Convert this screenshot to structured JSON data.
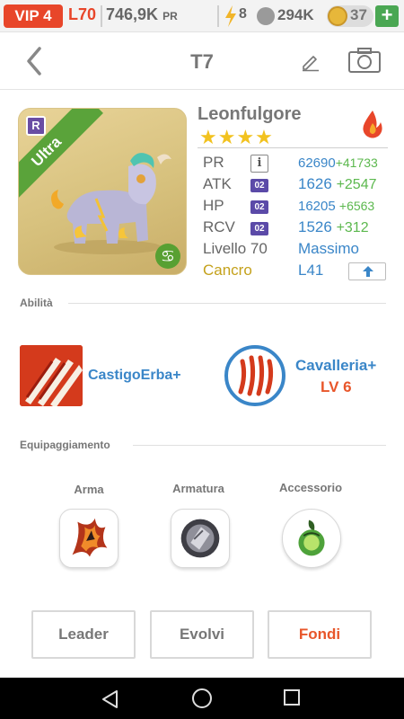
{
  "status": {
    "vip": "VIP 4",
    "level": "L70",
    "pr": "746,9K",
    "pr_unit": "PR",
    "energy": "8",
    "food": "294K",
    "coins": "37",
    "plus": "+"
  },
  "header": {
    "title": "T7"
  },
  "monster": {
    "name": "Leonfulgore",
    "rarity_tag": "Ultra",
    "rarity_badge": "R",
    "zodiac_symbol": "♋",
    "stars": "★★★★",
    "element": "fire",
    "stats": {
      "pr": {
        "label": "PR",
        "value": "62690",
        "bonus": "+41733"
      },
      "atk": {
        "label": "ATK",
        "badge": "02",
        "value": "1626",
        "bonus": "+2547"
      },
      "hp": {
        "label": "HP",
        "badge": "02",
        "value": "16205",
        "bonus": "+6563"
      },
      "rcv": {
        "label": "RCV",
        "badge": "02",
        "value": "1526",
        "bonus": "+312"
      }
    },
    "level_label": "Livello 70",
    "level_status": "Massimo",
    "zodiac_name": "Cancro",
    "league": "L41"
  },
  "abilities": {
    "section_label": "Abilità",
    "skill1": {
      "name": "CastigoErba+"
    },
    "skill2": {
      "name": "Cavalleria+",
      "level": "LV 6"
    }
  },
  "equipment": {
    "section_label": "Equipaggiamento",
    "slots": [
      {
        "label": "Arma"
      },
      {
        "label": "Armatura"
      },
      {
        "label": "Accessorio"
      }
    ]
  },
  "actions": {
    "leader": "Leader",
    "evolve": "Evolvi",
    "merge": "Fondi"
  },
  "colors": {
    "accent_red": "#e8462a",
    "blue": "#3a86c8",
    "green": "#5cb84e",
    "gold": "#c4a11b",
    "purple": "#5b4aa8"
  },
  "icons": [
    "back-icon",
    "edit-icon",
    "camera-icon",
    "fire-element-icon",
    "info-icon",
    "upgrade-arrow-icon"
  ]
}
